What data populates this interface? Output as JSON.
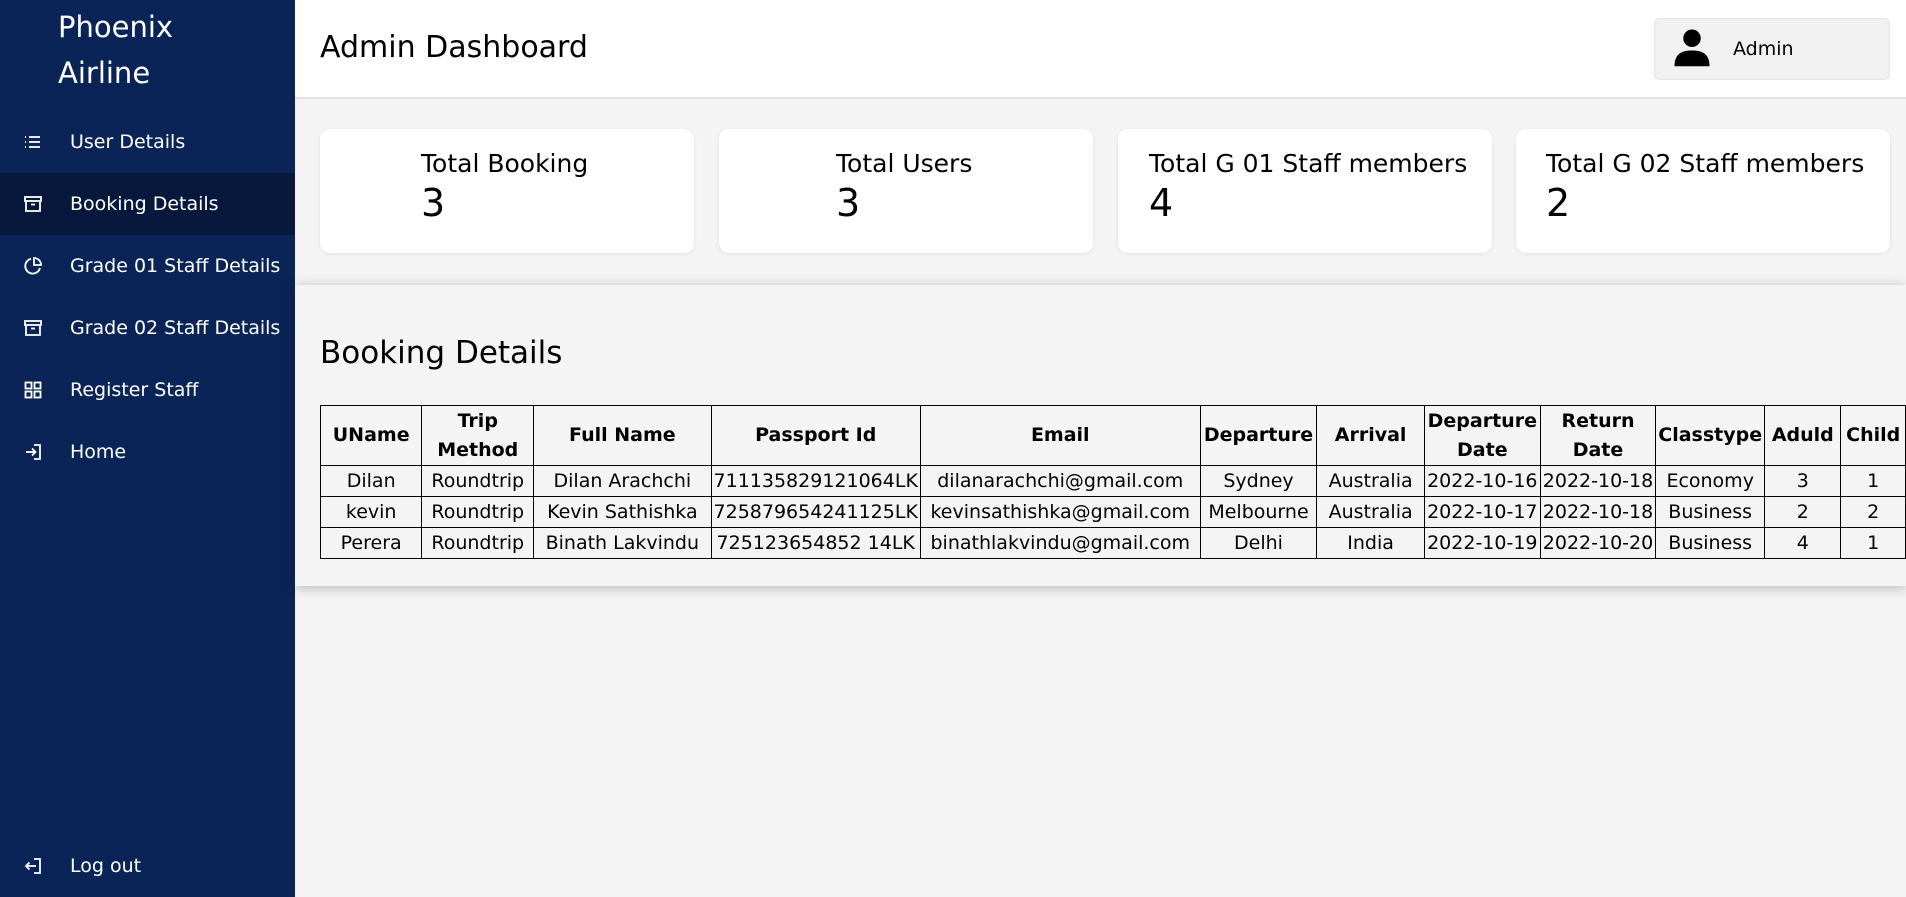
{
  "brand": {
    "line1": "Phoenix",
    "line2": "Airline"
  },
  "sidebar": {
    "items": [
      {
        "label": "User Details",
        "icon": "list-icon"
      },
      {
        "label": "Booking Details",
        "icon": "archive-icon",
        "active": true
      },
      {
        "label": "Grade 01 Staff Details",
        "icon": "pie-chart-icon"
      },
      {
        "label": "Grade 02 Staff Details",
        "icon": "archive-icon"
      },
      {
        "label": "Register Staff",
        "icon": "grid-icon"
      },
      {
        "label": "Home",
        "icon": "log-in-icon"
      }
    ],
    "logout": {
      "label": "Log out",
      "icon": "log-out-icon"
    }
  },
  "header": {
    "title": "Admin Dashboard",
    "user": "Admin"
  },
  "stats": [
    {
      "label": "Total Booking",
      "value": "3"
    },
    {
      "label": "Total Users",
      "value": "3"
    },
    {
      "label": "Total G 01 Staff members",
      "value": "4"
    },
    {
      "label": "Total G 02 Staff members",
      "value": "2"
    }
  ],
  "booking": {
    "title": "Booking Details",
    "columns": [
      "UName",
      "Trip Method",
      "Full Name",
      "Passport Id",
      "Email",
      "Departure",
      "Arrival",
      "Departure Date",
      "Return Date",
      "Classtype",
      "Aduld",
      "Child"
    ],
    "rows": [
      [
        "Dilan",
        "Roundtrip",
        "Dilan Arachchi",
        "711135829121064LK",
        "dilanarachchi@gmail.com",
        "Sydney",
        "Australia",
        "2022-10-16",
        "2022-10-18",
        "Economy",
        "3",
        "1"
      ],
      [
        "kevin",
        "Roundtrip",
        "Kevin Sathishka",
        "725879654241125LK",
        "kevinsathishka@gmail.com",
        "Melbourne",
        "Australia",
        "2022-10-17",
        "2022-10-18",
        "Business",
        "2",
        "2"
      ],
      [
        "Perera",
        "Roundtrip",
        "Binath Lakvindu",
        "725123654852 14LK",
        "binathlakvindu@gmail.com",
        "Delhi",
        "India",
        "2022-10-19",
        "2022-10-20",
        "Business",
        "4",
        "1"
      ]
    ]
  },
  "colors": {
    "sidebar": "#0b2458",
    "sidebar_active": "#07183c",
    "background": "#f4f4f4"
  }
}
